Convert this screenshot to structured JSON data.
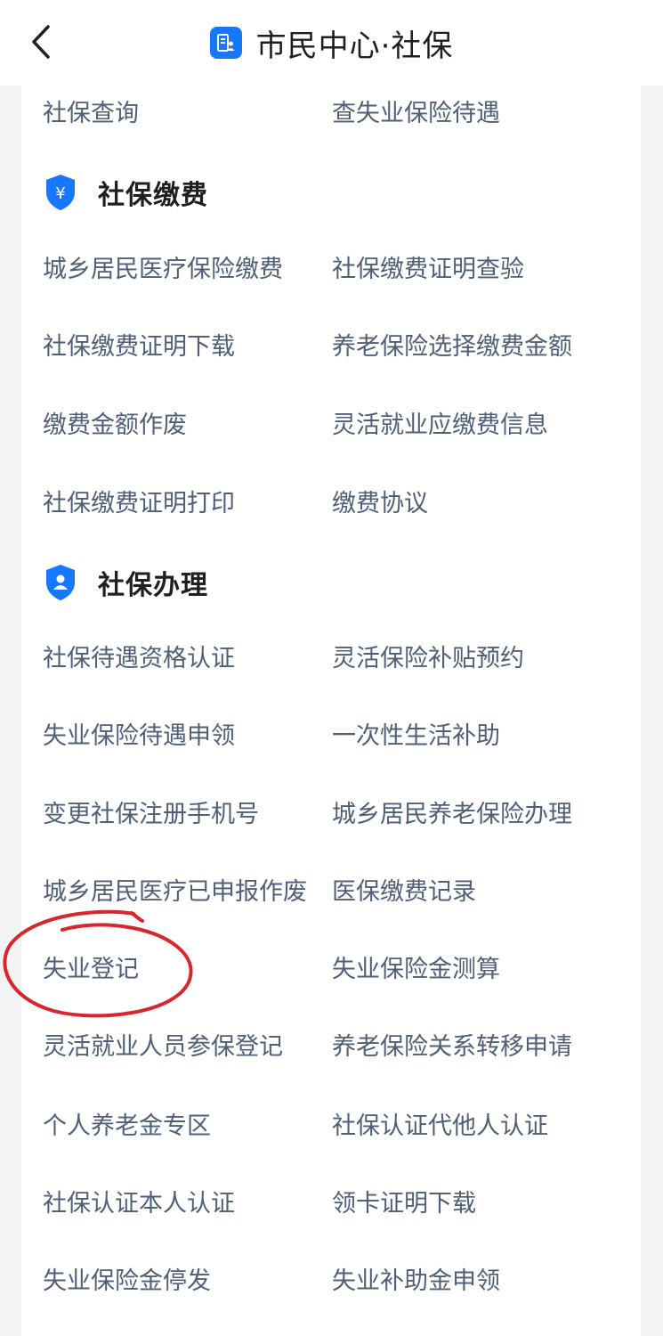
{
  "header": {
    "title": "市民中心·社保"
  },
  "first_row": {
    "left": "社保查询",
    "right": "查失业保险待遇"
  },
  "payment_section": {
    "title": "社保缴费",
    "icon_glyph": "¥",
    "rows": [
      {
        "left": "城乡居民医疗保险缴费",
        "right": "社保缴费证明查验"
      },
      {
        "left": "社保缴费证明下载",
        "right": "养老保险选择缴费金额"
      },
      {
        "left": "缴费金额作废",
        "right": "灵活就业应缴费信息"
      },
      {
        "left": "社保缴费证明打印",
        "right": "缴费协议"
      }
    ]
  },
  "handling_section": {
    "title": "社保办理",
    "rows": [
      {
        "left": "社保待遇资格认证",
        "right": "灵活保险补贴预约"
      },
      {
        "left": "失业保险待遇申领",
        "right": "一次性生活补助"
      },
      {
        "left": "变更社保注册手机号",
        "right": "城乡居民养老保险办理"
      },
      {
        "left": "城乡居民医疗已申报作废",
        "right": "医保缴费记录"
      },
      {
        "left": "失业登记",
        "right": "失业保险金测算"
      },
      {
        "left": "灵活就业人员参保登记",
        "right": "养老保险关系转移申请"
      },
      {
        "left": "个人养老金专区",
        "right": "社保认证代他人认证"
      },
      {
        "left": "社保认证本人认证",
        "right": "领卡证明下载"
      },
      {
        "left": "失业保险金停发",
        "right": "失业补助金申领"
      }
    ]
  },
  "colors": {
    "accent": "#1677ff",
    "annotation": "#d9262c"
  }
}
